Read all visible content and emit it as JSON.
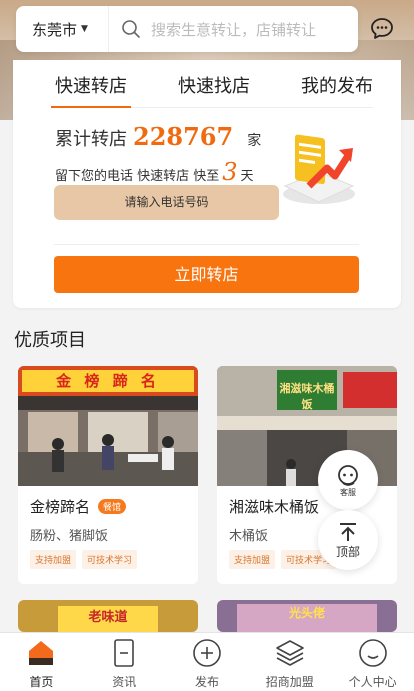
{
  "header": {
    "city": "东莞市",
    "search_placeholder": "搜索生意转让，店铺转让"
  },
  "panel": {
    "tabs": [
      {
        "label": "快速转店",
        "active": true
      },
      {
        "label": "快速找店",
        "active": false
      },
      {
        "label": "我的发布",
        "active": false
      }
    ],
    "stat_label": "累计转店",
    "stat_value": "228767",
    "stat_unit": "家",
    "sub_prefix": "留下您的电话 快速转店 快至",
    "sub_highlight": "3",
    "sub_suffix": "天",
    "phone_placeholder": "请输入电话号码",
    "submit_label": "立即转店"
  },
  "section": {
    "title": "优质项目",
    "projects": [
      {
        "name": "金榜蹄名",
        "badge": "餐馆",
        "desc": "肠粉、猪脚饭",
        "tags": [
          "支持加盟",
          "可技术学习"
        ],
        "sign": "金 榜 蹄 名"
      },
      {
        "name": "湘滋味木桶饭",
        "badge": "",
        "desc": "木桶饭",
        "tags": [
          "支持加盟",
          "可技术学习"
        ],
        "sign": "湘滋味木桶饭"
      },
      {
        "name": "",
        "sign": "老味道"
      },
      {
        "name": "",
        "sign": "光头佬"
      }
    ]
  },
  "float": {
    "service_label": "客服",
    "top_label": "顶部"
  },
  "nav": [
    {
      "label": "首页",
      "icon": "home-icon",
      "active": true
    },
    {
      "label": "资讯",
      "icon": "document-icon",
      "active": false
    },
    {
      "label": "发布",
      "icon": "plus-circle-icon",
      "active": false
    },
    {
      "label": "招商加盟",
      "icon": "layers-icon",
      "active": false
    },
    {
      "label": "个人中心",
      "icon": "smile-icon",
      "active": false
    }
  ],
  "colors": {
    "accent": "#f7740f",
    "stat": "#f06a0f",
    "phone_bg": "#e8c7a6"
  }
}
